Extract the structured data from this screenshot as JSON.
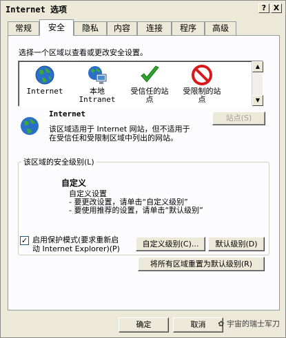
{
  "window": {
    "title": "Internet 选项",
    "help_btn": "?",
    "close_btn": "X"
  },
  "tabs": [
    "常规",
    "安全",
    "隐私",
    "内容",
    "连接",
    "程序",
    "高级"
  ],
  "security": {
    "instruction": "选择一个区域以查看或更改安全设置。",
    "zones": [
      {
        "label": "Internet",
        "icon": "globe-icon"
      },
      {
        "label": "本地",
        "label2": "Intranet",
        "icon": "intranet-icon"
      },
      {
        "label": "受信任的站",
        "label2": "点",
        "icon": "checkmark-icon"
      },
      {
        "label": "受限制的站",
        "label2": "点",
        "icon": "restricted-icon"
      }
    ],
    "selected_zone": {
      "title": "Internet",
      "desc1": "该区域适用于 Internet 网站，但不适用于",
      "desc2": "在受信任和受限制区域中列出的网站。",
      "sites_btn": "站点(S)"
    },
    "level_group": {
      "title": "该区域的安全级别(L)",
      "level_name": "自定义",
      "custom_line": "自定义设置",
      "hint1": "- 要更改设置，请单击“自定义级别”",
      "hint2": "- 要使用推荐的设置，请单击“默认级别”"
    },
    "protected_mode": {
      "checked": true,
      "check_mark": "✓",
      "label1": "启用保护模式(要求重新启",
      "label2": "动 Internet Explorer)(P)"
    },
    "custom_level_btn": "自定义级别(C)...",
    "default_level_btn": "默认级别(D)",
    "reset_all_btn": "将所有区域重置为默认级别(R)"
  },
  "footer": {
    "ok": "确定",
    "cancel": "取消",
    "watermark": "宇宙的瑞士军刀"
  },
  "colors": {
    "accent": "#1c5180",
    "check_green": "#2ea12e",
    "restricted_red": "#d8191a",
    "globe_blue": "#2a70c8"
  }
}
